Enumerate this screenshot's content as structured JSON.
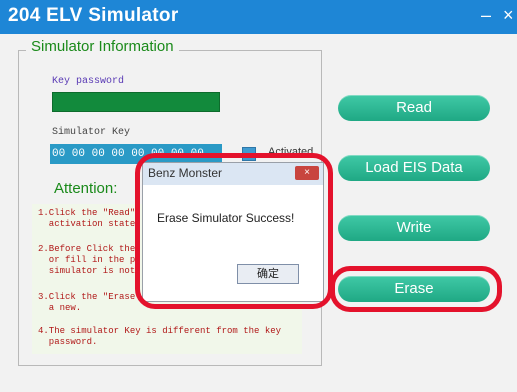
{
  "window": {
    "title": "204 ELV Simulator",
    "minimize_glyph": "–",
    "close_glyph": "×"
  },
  "panel": {
    "title": "Simulator Information",
    "key_password_label": "Key password",
    "simulator_key_label": "Simulator Key",
    "simulator_key_value": "00 00 00 00 00 00 00 00",
    "activated_label": "Activated",
    "attention_label": "Attention:"
  },
  "notes": [
    "1.Click the \"Read\"\n  activation state",
    "2.Before Click the\n  or fill in the p\n  simulator is not",
    "3.Click the \"Erase\n  a new.",
    "4.The simulator Key is different from the key\n  password."
  ],
  "buttons": {
    "read": "Read",
    "load_eis": "Load EIS Data",
    "write": "Write",
    "erase": "Erase"
  },
  "dialog": {
    "title": "Benz Monster",
    "message": "Erase Simulator Success!",
    "ok": "确定",
    "close_glyph": "×"
  },
  "colors": {
    "titlebar": "#1e86d6",
    "button": "#22ad89",
    "highlight": "#e4122c",
    "key_password_bar": "#128a3c"
  }
}
